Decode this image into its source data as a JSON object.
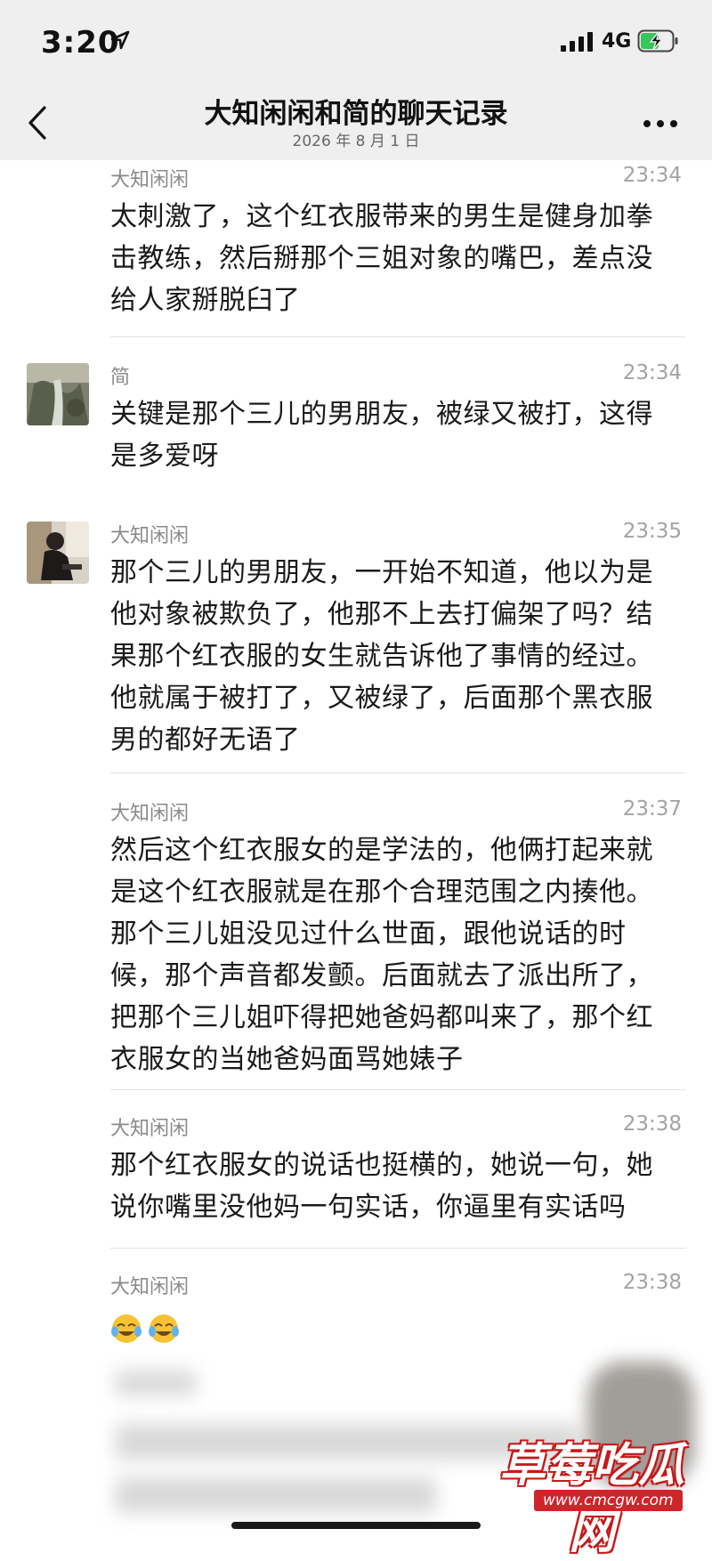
{
  "status_bar": {
    "time": "3:20",
    "network": "4G"
  },
  "nav": {
    "title": "大知闲闲和简的聊天记录",
    "subtitle": "2026 年 8 月 1 日"
  },
  "messages": [
    {
      "sender": "大知闲闲",
      "time": "23:34",
      "lines": [
        "太刺激了，这个红衣服带来的男生是健身加拳",
        "击教练，然后掰那个三姐对象的嘴巴，差点没",
        "给人家掰脱臼了"
      ]
    },
    {
      "sender": "简",
      "time": "23:34",
      "lines": [
        "关键是那个三儿的男朋友，被绿又被打，这得",
        "是多爱呀"
      ]
    },
    {
      "sender": "大知闲闲",
      "time": "23:35",
      "lines": [
        "那个三儿的男朋友，一开始不知道，他以为是",
        "他对象被欺负了，他那不上去打偏架了吗？结",
        "果那个红衣服的女生就告诉他了事情的经过。",
        "他就属于被打了，又被绿了，后面那个黑衣服",
        "男的都好无语了"
      ]
    },
    {
      "sender": "大知闲闲",
      "time": "23:37",
      "lines": [
        "然后这个红衣服女的是学法的，他俩打起来就",
        "是这个红衣服就是在那个合理范围之内揍他。",
        "那个三儿姐没见过什么世面，跟他说话的时",
        "候，那个声音都发颤。后面就去了派出所了，",
        "把那个三儿姐吓得把她爸妈都叫来了，那个红",
        "衣服女的当她爸妈面骂她婊子"
      ]
    },
    {
      "sender": "大知闲闲",
      "time": "23:38",
      "lines": [
        "那个红衣服女的说话也挺横的，她说一句，她",
        "说你嘴里没他妈一句实话，你逼里有实话吗"
      ]
    },
    {
      "sender": "大知闲闲",
      "time": "23:38",
      "lines": []
    }
  ],
  "watermark": {
    "text": "草莓吃瓜网",
    "url": "www.cmcgw.com"
  },
  "icons": [
    "location-arrow-icon",
    "signal-icon",
    "battery-charging-icon",
    "back-chevron-icon",
    "more-icon",
    "laughing-crying-emoji-icon"
  ]
}
